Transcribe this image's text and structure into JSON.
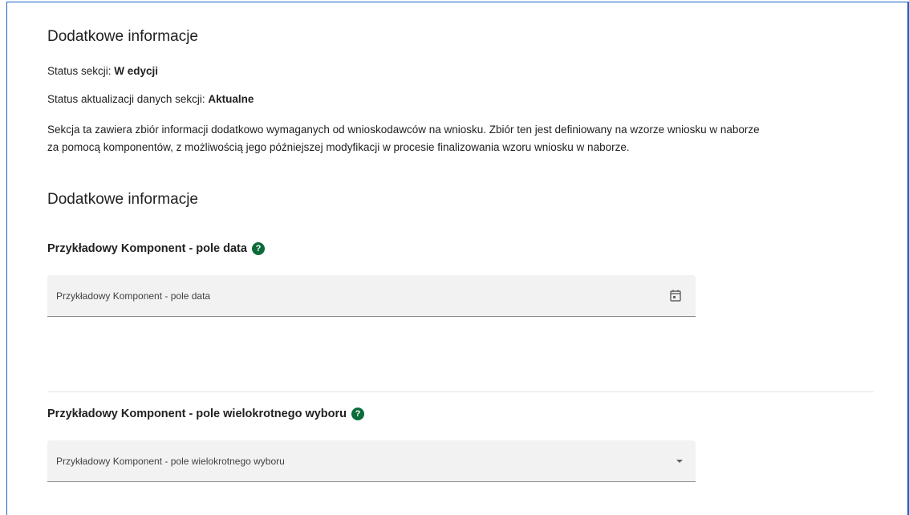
{
  "section": {
    "title": "Dodatkowe informacje",
    "status_label": "Status sekcji:",
    "status_value": "W edycji",
    "update_status_label": "Status aktualizacji danych sekcji:",
    "update_status_value": "Aktualne",
    "description_line1": "Sekcja ta zawiera zbiór informacji dodatkowo wymaganych od wnioskodawców na wniosku. Zbiór ten jest definiowany na wzorze wniosku w naborze",
    "description_line2": "za pomocą komponentów, z możliwością jego późniejszej modyfikacji w procesie finalizowania wzoru wniosku w naborze."
  },
  "subsection": {
    "title": "Dodatkowe informacje"
  },
  "date_field": {
    "label": "Przykładowy Komponent - pole data",
    "placeholder": "Przykładowy Komponent - pole data",
    "icon": "calendar-icon"
  },
  "multiselect_field": {
    "label": "Przykładowy Komponent - pole wielokrotnego wyboru",
    "placeholder": "Przykładowy Komponent - pole wielokrotnego wyboru",
    "icon": "arrow-drop-down-icon"
  },
  "help_icon": {
    "glyph": "?",
    "color": "#0b6b3a"
  },
  "colors": {
    "frame_border": "#1565c0",
    "field_background": "#f2f2f2"
  }
}
